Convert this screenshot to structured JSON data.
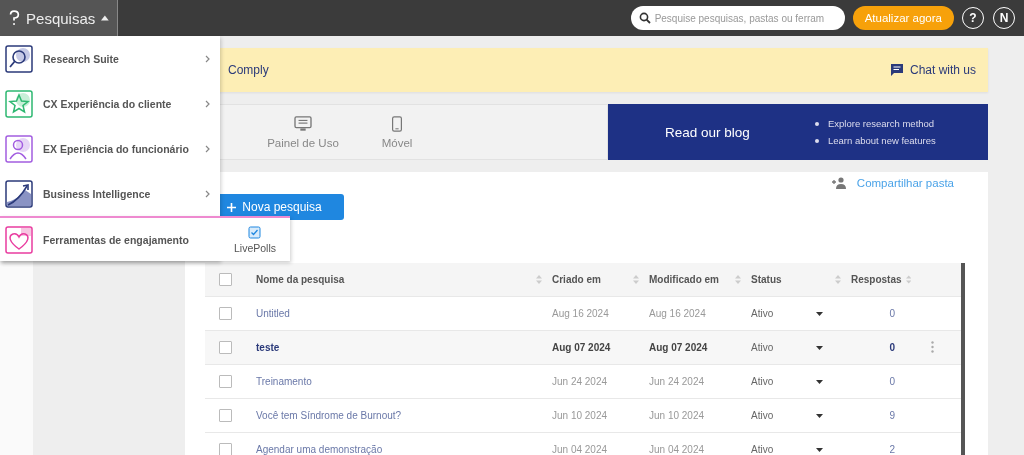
{
  "topbar": {
    "app_menu": {
      "label": "Pesquisas",
      "expanded": true
    },
    "search": {
      "placeholder": "Pesquise pesquisas, pastas ou ferram"
    },
    "upgrade_button": "Atualizar agora",
    "help_button": "?",
    "avatar": "N"
  },
  "app_menu_items": [
    {
      "kind": "research",
      "label": "Research Suite",
      "selected": false
    },
    {
      "kind": "cx",
      "label": "CX Experiência do cliente",
      "selected": false
    },
    {
      "kind": "ex",
      "label": "EX Eperiência do funcionário",
      "selected": false
    },
    {
      "kind": "bi",
      "label": "Business Intelligence",
      "selected": false
    },
    {
      "kind": "engagement",
      "label": "Ferramentas de engajamento",
      "selected": true,
      "submenu": [
        {
          "label": "LivePolls"
        }
      ]
    }
  ],
  "banner": {
    "text": "Comply",
    "chat_link": "Chat with us"
  },
  "tabs": [
    {
      "kind": "dashboard",
      "label": "Painel de Uso"
    },
    {
      "kind": "mobile",
      "label": "Móvel"
    }
  ],
  "blog": {
    "title": "Read our blog",
    "points": [
      "Explore research method",
      "Learn about new features"
    ]
  },
  "share_link": "Compartilhar pasta",
  "new_survey_button": "Nova pesquisa",
  "table": {
    "header_checked": false,
    "columns": [
      "Nome da pesquisa",
      "Criado em",
      "Modificado em",
      "Status",
      "Respostas"
    ],
    "rows": [
      {
        "checked": false,
        "highlighted": false,
        "name": "Untitled",
        "created": "Aug 16 2024",
        "modified": "Aug 16 2024",
        "status": "Ativo",
        "responses": "0"
      },
      {
        "checked": false,
        "highlighted": true,
        "name": "teste",
        "created": "Aug 07 2024",
        "modified": "Aug 07 2024",
        "status": "Ativo",
        "responses": "0"
      },
      {
        "checked": false,
        "highlighted": false,
        "name": "Treinamento",
        "created": "Jun 24 2024",
        "modified": "Jun 24 2024",
        "status": "Ativo",
        "responses": "0"
      },
      {
        "checked": false,
        "highlighted": false,
        "name": "Você tem Síndrome de Burnout?",
        "created": "Jun 10 2024",
        "modified": "Jun 10 2024",
        "status": "Ativo",
        "responses": "9"
      },
      {
        "checked": false,
        "highlighted": false,
        "name": "Agendar uma demonstração",
        "created": "Jun 04 2024",
        "modified": "Jun 04 2024",
        "status": "Ativo",
        "responses": "2"
      }
    ]
  }
}
